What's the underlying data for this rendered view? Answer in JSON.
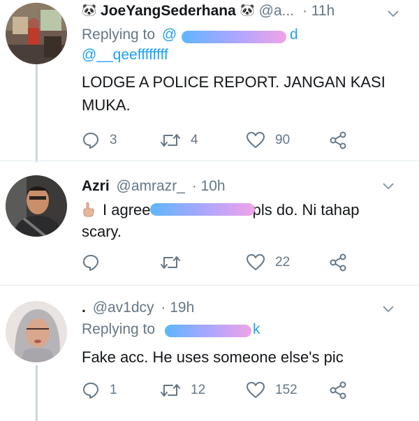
{
  "tweets": [
    {
      "name": "JoeYangSederhana",
      "name_emoji_icon": "panda-face-icon",
      "handle": "@a...",
      "time": "· 11h",
      "replying_label": "Replying to",
      "mention_partial": "@",
      "mention_tail": "d",
      "mention2": "@__qeeffffffff",
      "text": "LODGE A POLICE REPORT. JANGAN KASI MUKA.",
      "replies": "3",
      "retweets": "4",
      "likes": "90"
    },
    {
      "name": "Azri",
      "handle": "@amrazr_",
      "time": "· 10h",
      "text_pre": "I agree",
      "text_post": " pls do. Ni tahap scary.",
      "hand_emoji_icon": "pointing-up-hand-icon",
      "replies": "",
      "retweets": "",
      "likes": "22"
    },
    {
      "name": ".",
      "handle": "@av1dcy",
      "time": "· 19h",
      "replying_label": "Replying to",
      "mention_tail": "k",
      "text": "Fake acc. He uses someone else's pic",
      "replies": "1",
      "retweets": "12",
      "likes": "152"
    }
  ],
  "colors": {
    "link_blue": "#1da1f2",
    "muted_gray": "#657786",
    "separator": "#e1e8ed"
  }
}
